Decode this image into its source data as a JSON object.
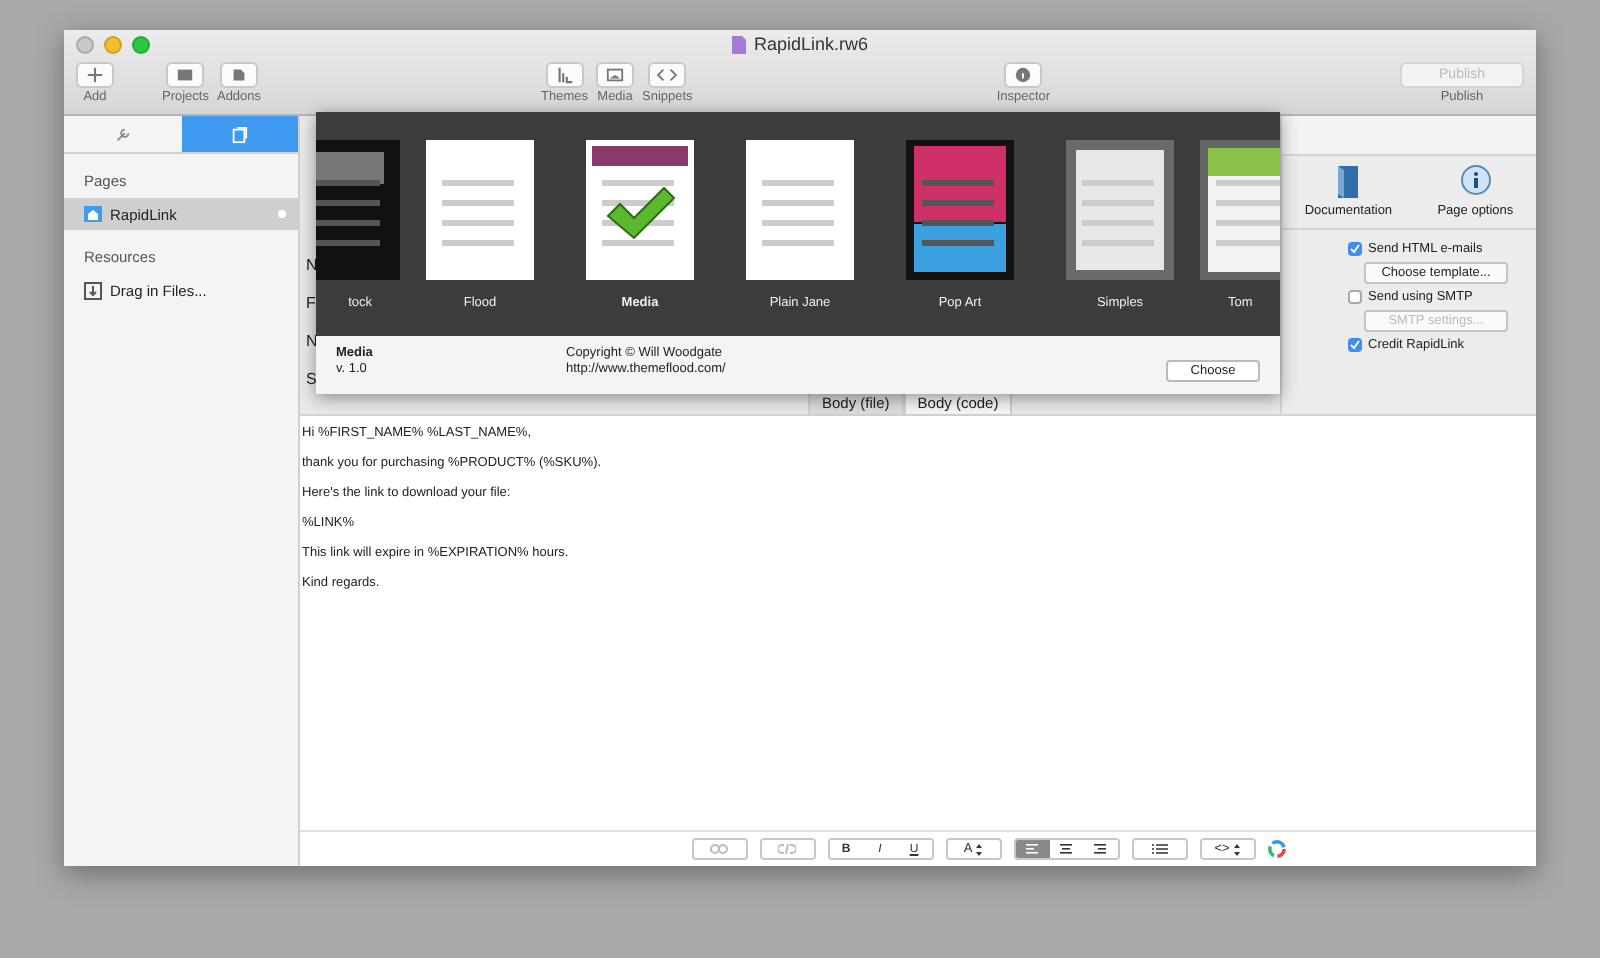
{
  "window": {
    "title": "RapidLink.rw6"
  },
  "toolbar": [
    {
      "label": "Add",
      "kind": "plus"
    },
    {
      "label": "Projects",
      "kind": "projects"
    },
    {
      "label": "Addons",
      "kind": "addons"
    },
    {
      "label": "Themes",
      "kind": "themes"
    },
    {
      "label": "Media",
      "kind": "media"
    },
    {
      "label": "Snippets",
      "kind": "snippets"
    },
    {
      "label": "Inspector",
      "kind": "info"
    }
  ],
  "publish": {
    "button": "Publish",
    "label": "Publish",
    "disabled": true
  },
  "sidebar": {
    "tabs": [
      {
        "kind": "wrench",
        "selected": false
      },
      {
        "kind": "pages",
        "selected": true
      }
    ],
    "sections": [
      {
        "title": "Pages",
        "items": [
          {
            "label": "RapidLink",
            "kind": "home",
            "selected": true
          }
        ]
      },
      {
        "title": "Resources",
        "items": [
          {
            "label": "Drag in Files...",
            "kind": "drag",
            "selected": false
          }
        ]
      }
    ]
  },
  "form_labels": [
    "N",
    "F",
    "N",
    "S"
  ],
  "theme_picker": {
    "themes": [
      {
        "name": "tock",
        "selected": false
      },
      {
        "name": "Flood",
        "selected": false
      },
      {
        "name": "Media",
        "selected": true
      },
      {
        "name": "Plain Jane",
        "selected": false
      },
      {
        "name": "Pop Art",
        "selected": false
      },
      {
        "name": "Simples",
        "selected": false
      },
      {
        "name": "Tom",
        "selected": false
      }
    ],
    "info": {
      "name": "Media",
      "version": "v. 1.0",
      "copyright": "Copyright © Will Woodgate",
      "url": "http://www.themeflood.com/"
    },
    "choose_button": "Choose"
  },
  "inspector": {
    "icons": [
      {
        "label": "Documentation",
        "kind": "book"
      },
      {
        "label": "Page options",
        "kind": "info"
      }
    ],
    "options": [
      {
        "kind": "checkbox",
        "label": "Send HTML e-mails",
        "checked": true
      },
      {
        "kind": "button",
        "label": "Choose template...",
        "disabled": false
      },
      {
        "kind": "checkbox",
        "label": "Send using SMTP",
        "checked": false
      },
      {
        "kind": "button",
        "label": "SMTP settings...",
        "disabled": true
      },
      {
        "kind": "checkbox",
        "label": "Credit RapidLink",
        "checked": true
      }
    ]
  },
  "body_tabs": [
    {
      "label": "Body (file)",
      "selected": true
    },
    {
      "label": "Body (code)",
      "selected": false
    }
  ],
  "editor_lines": [
    "Hi %FIRST_NAME% %LAST_NAME%,",
    "thank you for purchasing %PRODUCT% (%SKU%).",
    "Here's the link to download your file:",
    "%LINK%",
    "This link will expire in %EXPIRATION% hours.",
    "Kind regards."
  ],
  "format_bar": [
    {
      "kind": "link",
      "disabled": true
    },
    {
      "kind": "unlink",
      "disabled": true
    },
    {
      "kind": "segmented",
      "items": [
        {
          "label": "B",
          "selected": false
        },
        {
          "label": "I",
          "selected": false
        },
        {
          "label": "U",
          "selected": false
        }
      ]
    },
    {
      "kind": "popup",
      "label": "A"
    },
    {
      "kind": "align",
      "items": [
        {
          "selected": true
        },
        {
          "selected": false
        },
        {
          "selected": false
        }
      ]
    },
    {
      "kind": "list",
      "disabled": false
    },
    {
      "kind": "popup",
      "label": "<>"
    },
    {
      "kind": "color"
    }
  ]
}
